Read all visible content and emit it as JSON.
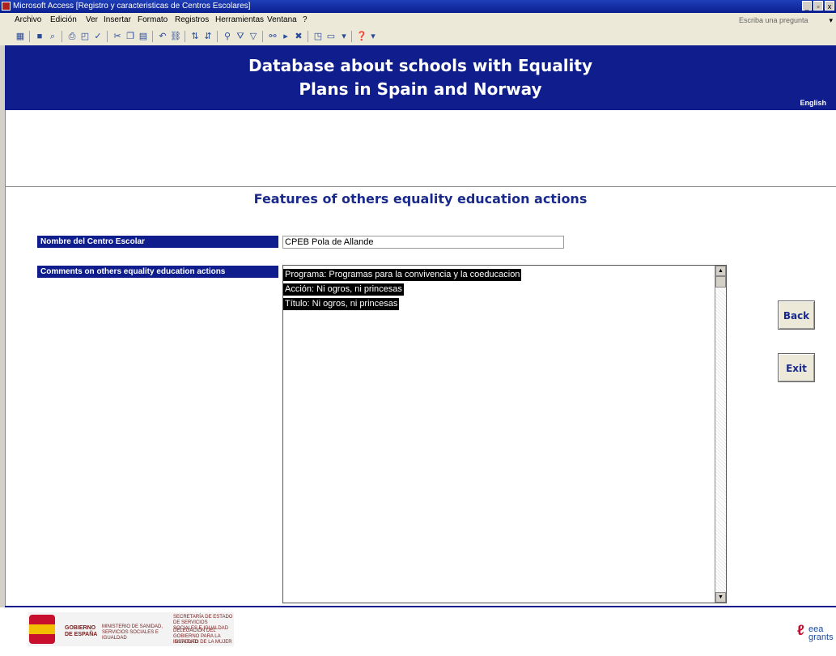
{
  "window": {
    "title": "Microsoft Access  [Registro y caracteristicas de Centros Escolares]",
    "controls": [
      "_",
      "▫",
      "x"
    ]
  },
  "menu": {
    "items": [
      "Archivo",
      "Edición",
      "Ver",
      "Insertar",
      "Formato",
      "Registros",
      "Herramientas",
      "Ventana",
      "?"
    ],
    "help_placeholder": "Escriba una pregunta",
    "help_dropdown": "▾"
  },
  "header": {
    "line1": "Database about schools with Equality",
    "line2": "Plans in Spain and Norway",
    "language": "English"
  },
  "section": {
    "title": "Features of others equality education actions"
  },
  "form": {
    "school_label": "Nombre del Centro Escolar",
    "school_value": "CPEB Pola de Allande",
    "comments_label": "Comments on others equality education actions",
    "comments_lines": [
      "Programa: Programas para la convivencia y la coeducacion",
      "Acción: Ni ogros, ni princesas",
      "Título: Ni ogros, ni princesas"
    ]
  },
  "buttons": {
    "back": "Back",
    "exit": "Exit"
  },
  "footer": {
    "gob_line1": "GOBIERNO",
    "gob_line2": "DE ESPAÑA",
    "ministry": "MINISTERIO DE SANIDAD, SERVICIOS SOCIALES E IGUALDAD",
    "secretary": "SECRETARÍA DE ESTADO DE SERVICIOS SOCIALES E IGUALDAD",
    "delegation": "DELEGACIÓN DEL GOBIERNO PARA LA IGUALDAD",
    "institute": "INSTITUTO DE LA MUJER",
    "eea": "eea",
    "grants": "grants"
  }
}
